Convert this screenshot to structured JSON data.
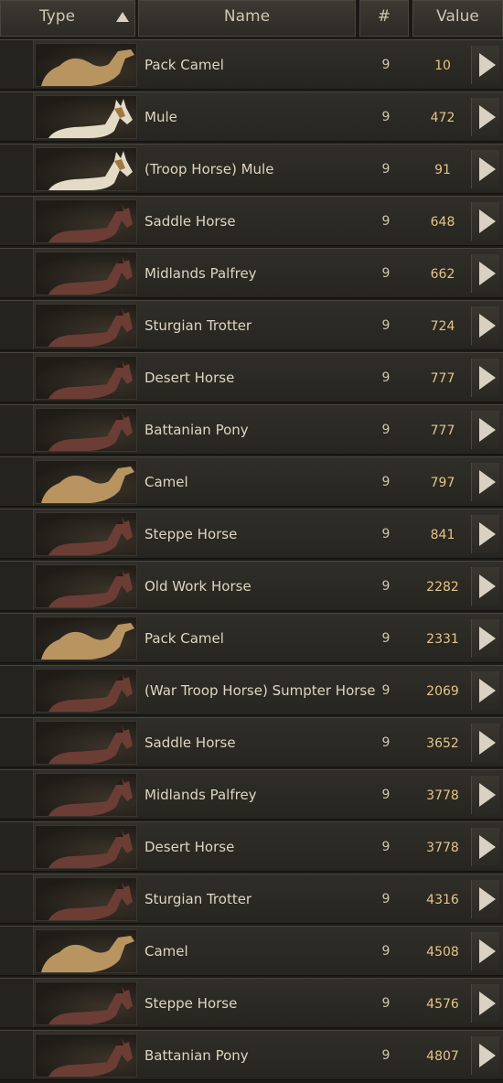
{
  "header": {
    "type_label": "Type",
    "name_label": "Name",
    "count_label": "#",
    "value_label": "Value"
  },
  "colors": {
    "value_text": "#e5c489",
    "name_text": "#ddd5c4",
    "camel": "#b89460",
    "mule": "#e4dbc7",
    "horse": "#6b3d35"
  },
  "rows": [
    {
      "kind": "camel",
      "name": "Pack Camel",
      "count": "9",
      "value": "10"
    },
    {
      "kind": "mule",
      "name": "Mule",
      "count": "9",
      "value": "472"
    },
    {
      "kind": "mule",
      "name": "(Troop Horse) Mule",
      "count": "9",
      "value": "91"
    },
    {
      "kind": "horse",
      "name": "Saddle Horse",
      "count": "9",
      "value": "648"
    },
    {
      "kind": "horse",
      "name": "Midlands Palfrey",
      "count": "9",
      "value": "662"
    },
    {
      "kind": "horse",
      "name": "Sturgian Trotter",
      "count": "9",
      "value": "724"
    },
    {
      "kind": "horse",
      "name": "Desert Horse",
      "count": "9",
      "value": "777"
    },
    {
      "kind": "horse",
      "name": "Battanian Pony",
      "count": "9",
      "value": "777"
    },
    {
      "kind": "camel",
      "name": "Camel",
      "count": "9",
      "value": "797"
    },
    {
      "kind": "horse",
      "name": "Steppe Horse",
      "count": "9",
      "value": "841"
    },
    {
      "kind": "horse",
      "name": "Old Work Horse",
      "count": "9",
      "value": "2282"
    },
    {
      "kind": "camel",
      "name": "Pack Camel",
      "count": "9",
      "value": "2331"
    },
    {
      "kind": "horse",
      "name": "(War Troop Horse) Sumpter Horse",
      "count": "9",
      "value": "2069"
    },
    {
      "kind": "horse",
      "name": "Saddle Horse",
      "count": "9",
      "value": "3652"
    },
    {
      "kind": "horse",
      "name": "Midlands Palfrey",
      "count": "9",
      "value": "3778"
    },
    {
      "kind": "horse",
      "name": "Desert Horse",
      "count": "9",
      "value": "3778"
    },
    {
      "kind": "horse",
      "name": "Sturgian Trotter",
      "count": "9",
      "value": "4316"
    },
    {
      "kind": "camel",
      "name": "Camel",
      "count": "9",
      "value": "4508"
    },
    {
      "kind": "horse",
      "name": "Steppe Horse",
      "count": "9",
      "value": "4576"
    },
    {
      "kind": "horse",
      "name": "Battanian Pony",
      "count": "9",
      "value": "4807"
    }
  ]
}
